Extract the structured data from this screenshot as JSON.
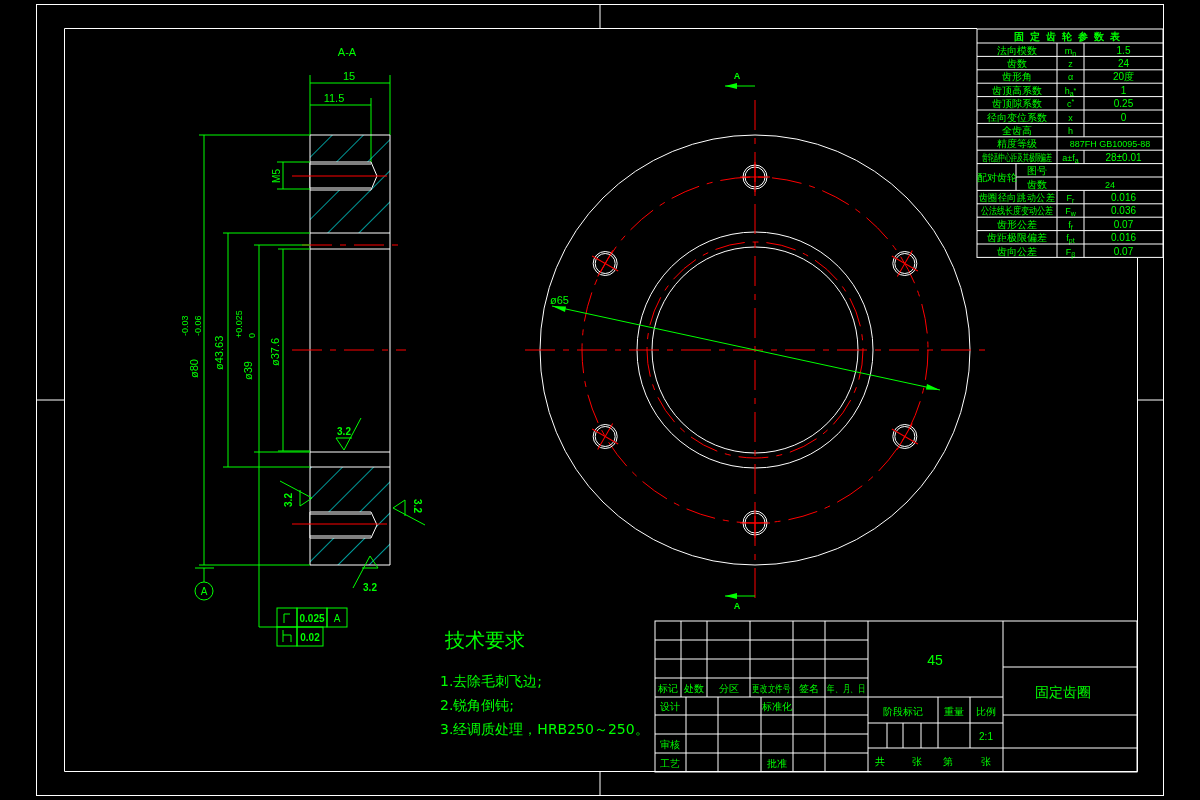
{
  "section_view": {
    "label": "A-A",
    "length_dims": [
      "15",
      "11.5"
    ],
    "thread_label": "M5",
    "diameters": [
      {
        "value": "ø80",
        "upper": "-0.03",
        "lower": "-0.06"
      },
      {
        "value": "ø43.63"
      },
      {
        "value": "ø39",
        "upper": "+0.025",
        "lower": "0"
      },
      {
        "value": "ø37.6"
      }
    ],
    "roughness": [
      "3.2",
      "3.2",
      "3.2",
      "3.2"
    ],
    "datum": "A"
  },
  "tolerance_frame": {
    "rows": [
      {
        "kind": "runout",
        "value": "0.025",
        "datum": "A"
      },
      {
        "kind": "flatness",
        "value": "0.02"
      }
    ]
  },
  "plan_view": {
    "section_marks": [
      "A",
      "A"
    ],
    "diameter_label": "ø65"
  },
  "parameter_table": {
    "title": "固定齿轮参数表",
    "rows": [
      {
        "kind": "single",
        "name": "法向模数",
        "symbol": "m$_{n}$",
        "value": "1.5"
      },
      {
        "kind": "single",
        "name": "齿数",
        "symbol": "z",
        "value": "24"
      },
      {
        "kind": "single",
        "name": "齿形角",
        "symbol": "α",
        "value": "20度"
      },
      {
        "kind": "single",
        "name": "齿顶高系数",
        "symbol": "h$_{a}$$^{*}$",
        "value": "1"
      },
      {
        "kind": "single",
        "name": "齿顶隙系数",
        "symbol": "c$^{*}$",
        "value": "0.25"
      },
      {
        "kind": "single",
        "name": "径向变位系数",
        "symbol": "x",
        "value": "0"
      },
      {
        "kind": "single",
        "name": "全齿高",
        "symbol": "h"
      },
      {
        "kind": "wide",
        "name": "精度等级",
        "value": "887FH GB10095-88"
      },
      {
        "kind": "single",
        "name": "齿轮副中心距及其极限偏差",
        "symbol": "a±f$_{a}$",
        "value": "28±0.01"
      },
      {
        "kind": "pair",
        "name": "配对齿轮",
        "items": [
          {
            "label": "图号"
          },
          {
            "label": "齿数",
            "value": "24"
          }
        ]
      },
      {
        "kind": "single",
        "name": "齿圈径向跳动公差",
        "symbol": "F$_{r}$",
        "value": "0.016"
      },
      {
        "kind": "single",
        "name": "公法线长度变动公差",
        "symbol": "F$_{w}$",
        "value": "0.036"
      },
      {
        "kind": "single",
        "name": "齿形公差",
        "symbol": "f$_{f}$",
        "value": "0.07"
      },
      {
        "kind": "single",
        "name": "齿距极限偏差",
        "symbol": "f$_{pt}$",
        "value": "0.016"
      },
      {
        "kind": "single",
        "name": "齿向公差",
        "symbol": "F$_{β}$",
        "value": "0.07"
      }
    ]
  },
  "tech_requirements": {
    "title": "技术要求",
    "items": [
      "1.去除毛刺飞边;",
      "2.锐角倒钝;",
      "3.经调质处理，HRB250～250。"
    ]
  },
  "title_block": {
    "revision_headers": [
      "标记",
      "处数",
      "分区",
      "更改文件号",
      "签名",
      "年、月、日"
    ],
    "approval_labels": [
      "设计",
      "标准化",
      "审核",
      "工艺",
      "批准"
    ],
    "material": "45",
    "part_name": "固定齿圈",
    "stage_headers": [
      "阶段标记",
      "重量",
      "比例"
    ],
    "scale": "2:1",
    "sheet_labels": [
      "共",
      "张",
      "第",
      "张"
    ]
  }
}
